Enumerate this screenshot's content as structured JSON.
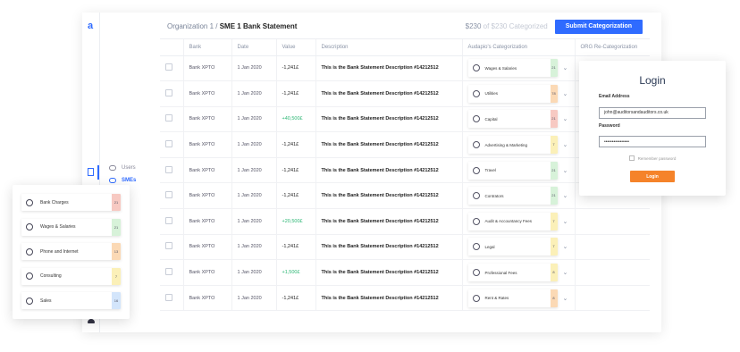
{
  "app": {
    "logo": "a"
  },
  "sidenav": [
    {
      "label": "Users",
      "icon": "users-icon",
      "active": false
    },
    {
      "label": "SMEs",
      "icon": "sme-icon",
      "active": true
    }
  ],
  "header": {
    "org": "Organization 1 /",
    "title": "SME 1 Bank Statement",
    "count_done": "$230",
    "count_rest": " of $230 Categorized",
    "submit_label": "Submit Categorization"
  },
  "table": {
    "columns": [
      "Bank",
      "Date",
      "Value",
      "Description",
      "Audapio's Categorization",
      "ORG Re-Categorization"
    ],
    "rows": [
      {
        "bank": "Bank XPTO",
        "date": "1 Jan 2020",
        "value": "-1,241£",
        "positive": false,
        "description": "This is the Bank Statement Description #14212512",
        "category": "Wages & Salaries",
        "icon": "user-icon",
        "score": "21",
        "score_color": "green"
      },
      {
        "bank": "Bank XPTO",
        "date": "1 Jan 2020",
        "value": "-1,241£",
        "positive": false,
        "description": "This is the Bank Statement Description #14212512",
        "category": "Utilities",
        "icon": "lightbulb-icon",
        "score": "78",
        "score_color": "orange"
      },
      {
        "bank": "Bank XPTO",
        "date": "1 Jan 2020",
        "value": "+40,500£",
        "positive": true,
        "description": "This is the Bank Statement Description #14212512",
        "category": "Capital",
        "icon": "target-icon",
        "score": "21",
        "score_color": "red"
      },
      {
        "bank": "Bank XPTO",
        "date": "1 Jan 2020",
        "value": "-1,241£",
        "positive": false,
        "description": "This is the Bank Statement Description #14212512",
        "category": "Advertising & Marketing",
        "icon": "chat-icon",
        "score": "7",
        "score_color": "yellow"
      },
      {
        "bank": "Bank XPTO",
        "date": "1 Jan 2020",
        "value": "-1,241£",
        "positive": false,
        "description": "This is the Bank Statement Description #14212512",
        "category": "Travel",
        "icon": "plane-icon",
        "score": "21",
        "score_color": "green"
      },
      {
        "bank": "Bank XPTO",
        "date": "1 Jan 2020",
        "value": "-1,241£",
        "positive": false,
        "description": "This is the Bank Statement Description #14212512",
        "category": "Contrators",
        "icon": "user-icon",
        "score": "21",
        "score_color": "green"
      },
      {
        "bank": "Bank XPTO",
        "date": "1 Jan 2020",
        "value": "+20,500£",
        "positive": true,
        "description": "This is the Bank Statement Description #14212512",
        "category": "Audit & Accountancy Fees",
        "icon": "chat-icon",
        "score": "7",
        "score_color": "yellow"
      },
      {
        "bank": "Bank XPTO",
        "date": "1 Jan 2020",
        "value": "-1,241£",
        "positive": false,
        "description": "This is the Bank Statement Description #14212512",
        "category": "Legal",
        "icon": "chat-icon",
        "score": "7",
        "score_color": "yellow"
      },
      {
        "bank": "Bank XPTO",
        "date": "1 Jan 2020",
        "value": "+1,500£",
        "positive": true,
        "description": "This is the Bank Statement Description #14212512",
        "category": "Professional Fees",
        "icon": "chat-icon",
        "score": "8",
        "score_color": "yellow"
      },
      {
        "bank": "Bank XPTO",
        "date": "1 Jan 2020",
        "value": "-1,241£",
        "positive": false,
        "description": "This is the Bank Statement Description #14212512",
        "category": "Rent & Rates",
        "icon": "lightbulb-icon",
        "score": "8",
        "score_color": "orange"
      }
    ]
  },
  "category_card": [
    {
      "label": "Bank Charges",
      "icon": "target-icon",
      "score": "21",
      "score_color": "red"
    },
    {
      "label": "Wages & Salaries",
      "icon": "user-icon",
      "score": "21",
      "score_color": "green"
    },
    {
      "label": "Phone and Internet",
      "icon": "globe-icon",
      "score": "13",
      "score_color": "orange"
    },
    {
      "label": "Consulting",
      "icon": "chat-icon",
      "score": "7",
      "score_color": "yellow"
    },
    {
      "label": "Sales",
      "icon": "tray-icon",
      "score": "16",
      "score_color": "blue"
    }
  ],
  "login": {
    "title": "Login",
    "email_label": "Email Address",
    "email_value": "john@auditorsandauditors.co.uk",
    "password_label": "Password",
    "password_value": "••••••••••••••••",
    "remember_label": "Remember password",
    "button_label": "Login"
  }
}
